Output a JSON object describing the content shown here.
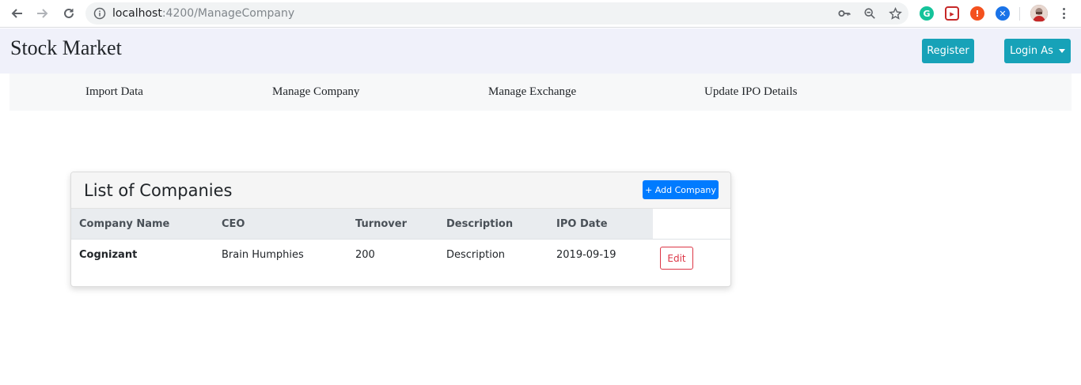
{
  "browser": {
    "url_host": "localhost",
    "url_path": ":4200/ManageCompany",
    "icons": [
      "back-arrow-icon",
      "forward-arrow-icon",
      "reload-icon",
      "info-icon",
      "key-icon",
      "zoom-icon",
      "star-icon"
    ]
  },
  "extensions": [
    {
      "name": "grammarly-extension-icon",
      "color": "#15c39a",
      "glyph": "G"
    },
    {
      "name": "red-media-extension-icon",
      "color": "#d93025",
      "glyph": "▸"
    },
    {
      "name": "orange-alert-extension-icon",
      "color": "#f4511e",
      "glyph": "!"
    },
    {
      "name": "blue-extension-icon",
      "color": "#1a73e8",
      "glyph": "✕"
    }
  ],
  "header": {
    "brand": "Stock Market",
    "register_label": "Register",
    "login_label": "Login As",
    "accent_color": "#17a2b8"
  },
  "subnav": {
    "items": [
      "Import Data",
      "Manage Company",
      "Manage Exchange",
      "Update IPO Details"
    ]
  },
  "card": {
    "title": "List of Companies",
    "add_label": "+ Add Company",
    "columns": [
      "Company Name",
      "CEO",
      "Turnover",
      "Description",
      "IPO Date"
    ],
    "rows": [
      {
        "company": "Cognizant",
        "ceo": "Brain Humphies",
        "turnover": "200",
        "description": "Description",
        "ipo_date": "2019-09-19",
        "edit_label": "Edit"
      }
    ]
  }
}
